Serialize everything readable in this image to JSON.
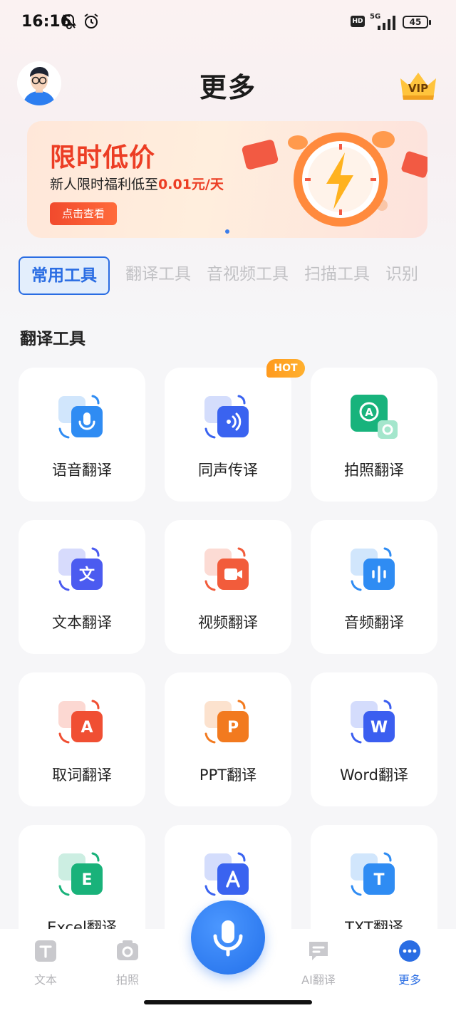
{
  "status_bar": {
    "time": "16:16",
    "hd": "HD",
    "network": "5G",
    "battery": "45"
  },
  "header": {
    "title": "更多",
    "vip": "VIP"
  },
  "banner": {
    "title": "限时低价",
    "subtitle_prefix": "新人限时福利低至",
    "subtitle_price": "0.01元/天",
    "button": "点击查看"
  },
  "tabs": [
    {
      "label": "常用工具",
      "active": true
    },
    {
      "label": "翻译工具",
      "active": false
    },
    {
      "label": "音视频工具",
      "active": false
    },
    {
      "label": "扫描工具",
      "active": false
    },
    {
      "label": "识别",
      "active": false
    }
  ],
  "section": {
    "title": "翻译工具"
  },
  "hot_badge": "HOT",
  "tools": [
    {
      "label": "语音翻译",
      "icon": "voice-translate-icon",
      "color": "#2f8cf3"
    },
    {
      "label": "同声传译",
      "icon": "simultaneous-interpretation-icon",
      "color": "#3a63f0"
    },
    {
      "label": "拍照翻译",
      "icon": "photo-translate-icon",
      "color": "#18b37c"
    },
    {
      "label": "文本翻译",
      "icon": "text-translate-icon",
      "color": "#4b5bf0"
    },
    {
      "label": "视频翻译",
      "icon": "video-translate-icon",
      "color": "#f25c3b"
    },
    {
      "label": "音频翻译",
      "icon": "audio-translate-icon",
      "color": "#2f8cf3"
    },
    {
      "label": "取词翻译",
      "icon": "word-capture-translate-icon",
      "color": "#f04f33"
    },
    {
      "label": "PPT翻译",
      "icon": "ppt-translate-icon",
      "color": "#f27a1f"
    },
    {
      "label": "Word翻译",
      "icon": "word-translate-icon",
      "color": "#3b5ef0"
    },
    {
      "label": "Excel翻译",
      "icon": "excel-translate-icon",
      "color": "#19b27a"
    },
    {
      "label": "",
      "icon": "pdf-translate-icon",
      "color": "#3a63f0"
    },
    {
      "label": "TXT翻译",
      "icon": "txt-translate-icon",
      "color": "#2f8cf3"
    }
  ],
  "bottom_nav": [
    {
      "label": "文本",
      "icon": "text-icon",
      "active": false
    },
    {
      "label": "拍照",
      "icon": "camera-icon",
      "active": false
    },
    {
      "label": "AI翻译",
      "icon": "ai-translate-icon",
      "active": false
    },
    {
      "label": "更多",
      "icon": "more-icon",
      "active": true
    }
  ],
  "colors": {
    "accent": "#2a6de3",
    "banner_red": "#ec3d24",
    "hot": "#ff9a1e"
  }
}
